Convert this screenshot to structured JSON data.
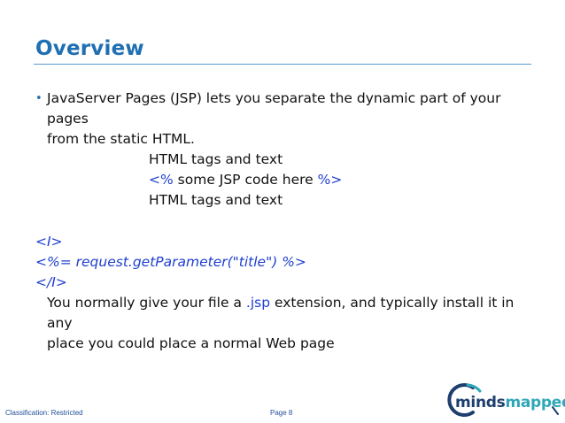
{
  "slide": {
    "title": "Overview",
    "bullet_line1": "JavaServer Pages (JSP) lets you separate the dynamic part of your pages",
    "bullet_line2": "from the static HTML.",
    "html_tags_1": "HTML tags and text",
    "jsp_open": "<%",
    "jsp_code": "some JSP code here",
    "jsp_close": "%>",
    "html_tags_2": "HTML tags and text",
    "code_i_open": "<I>",
    "code_expr": "<%= request.getParameter(\"title\") %>",
    "code_i_close": "</I>",
    "para_part1": "You normally give your file a",
    "para_ext": ".jsp",
    "para_part2": "extension, and typically install it in any",
    "para_line2": "place you could place a normal Web page"
  },
  "footer": {
    "classification": "Classification: Restricted",
    "page": "Page 8"
  },
  "logo": {
    "text_a": "minds",
    "text_b": "mapped"
  },
  "colors": {
    "title": "#1f6fb2",
    "code_blue": "#1f3fd0",
    "logo_dark": "#1d3e6e",
    "logo_teal": "#2fa7b8"
  }
}
